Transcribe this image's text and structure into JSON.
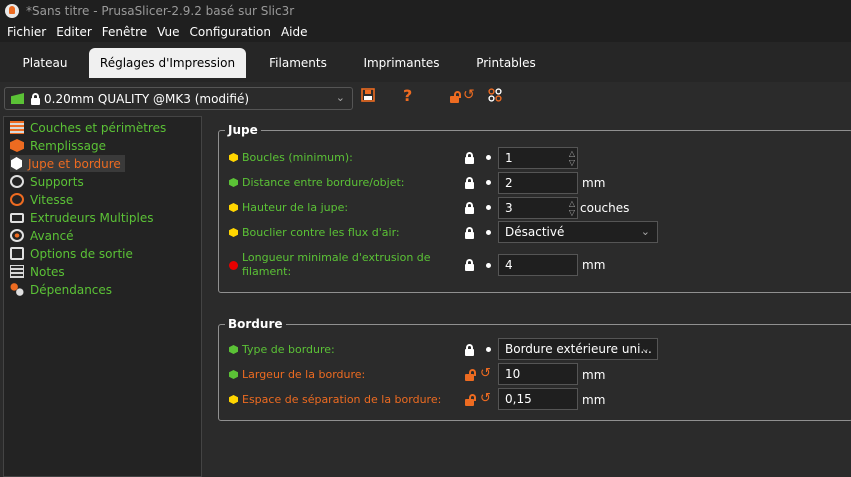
{
  "window": {
    "title": "*Sans titre - PrusaSlicer-2.9.2 basé sur Slic3r"
  },
  "menu": [
    "Fichier",
    "Editer",
    "Fenêtre",
    "Vue",
    "Configuration",
    "Aide"
  ],
  "tabs": [
    "Plateau",
    "Réglages d'Impression",
    "Filaments",
    "Imprimantes",
    "Printables"
  ],
  "active_tab": "Réglages d'Impression",
  "toolbar": {
    "preset": "0.20mm QUALITY @MK3 (modifié)",
    "save_icon": "save-icon",
    "help_icon": "question-mark-icon",
    "reset_icons": "unlock-undo-icon",
    "compare_icon": "compare-icon"
  },
  "sidebar": {
    "items": [
      {
        "label": "Couches et périmètres",
        "icon": "layers-icon"
      },
      {
        "label": "Remplissage",
        "icon": "infill-icon"
      },
      {
        "label": "Jupe et bordure",
        "icon": "skirt-icon"
      },
      {
        "label": "Supports",
        "icon": "supports-icon"
      },
      {
        "label": "Vitesse",
        "icon": "speed-icon"
      },
      {
        "label": "Extrudeurs Multiples",
        "icon": "multi-extruder-icon"
      },
      {
        "label": "Avancé",
        "icon": "advanced-icon"
      },
      {
        "label": "Options de sortie",
        "icon": "output-icon"
      },
      {
        "label": "Notes",
        "icon": "notes-icon"
      },
      {
        "label": "Dépendances",
        "icon": "dependencies-icon"
      }
    ],
    "selected": "Jupe et bordure"
  },
  "jupe": {
    "title": "Jupe",
    "rows": [
      {
        "label": "Boucles (minimum):",
        "value": "1",
        "unit": ""
      },
      {
        "label": "Distance entre bordure/objet:",
        "value": "2",
        "unit": "mm"
      },
      {
        "label": "Hauteur de la jupe:",
        "value": "3",
        "unit": "couches"
      },
      {
        "label": "Bouclier contre les flux d'air:",
        "value": "Désactivé",
        "unit": ""
      },
      {
        "label_line1": "Longueur minimale d'extrusion de",
        "label_line2": "filament:",
        "value": "4",
        "unit": "mm"
      }
    ]
  },
  "bordure": {
    "title": "Bordure",
    "rows": [
      {
        "label": "Type de bordure:",
        "value": "Bordure extérieure uni...",
        "unit": ""
      },
      {
        "label": "Largeur de la bordure:",
        "value": "10",
        "unit": "mm"
      },
      {
        "label": "Espace de séparation de la bordure:",
        "value": "0,15",
        "unit": "mm"
      }
    ]
  },
  "colors": {
    "background": "#2b2b2b",
    "accent_orange": "#ed6b21",
    "simple_green": "#5bc236",
    "advanced_yellow": "#ffd500",
    "expert_red": "#e70000"
  }
}
